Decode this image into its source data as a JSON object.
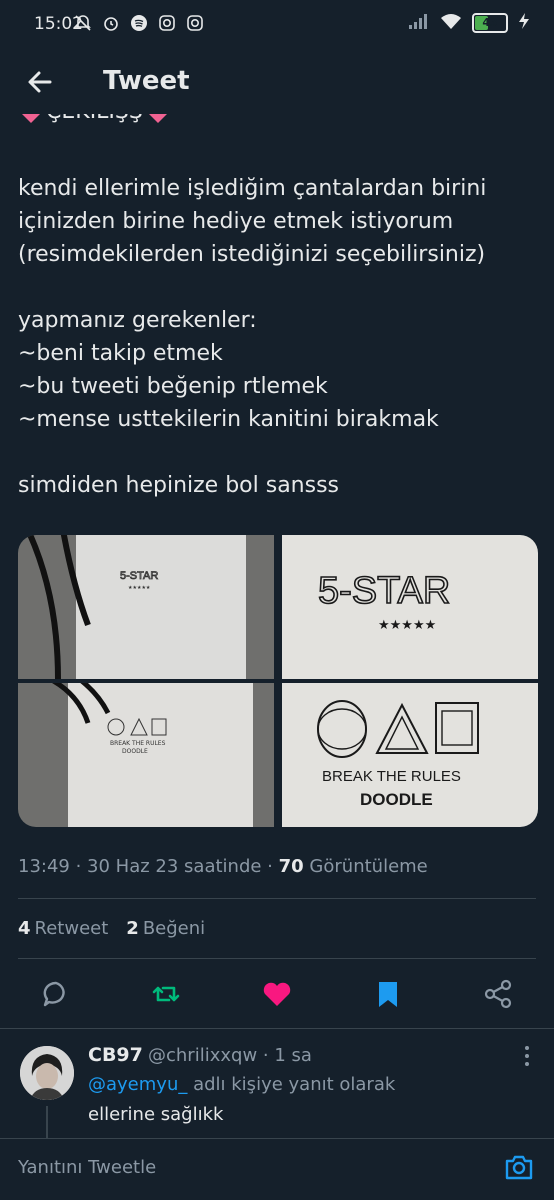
{
  "status_bar": {
    "time": "15:02",
    "battery_level": "43",
    "battery_fraction": 0.43
  },
  "header": {
    "title": "Tweet"
  },
  "tweet": {
    "heading": "ÇEKİLİŞŞ",
    "paragraph_1": "kendi ellerimle işlediğim çantalardan birini\niçinizden birine hediye etmek istiyorum\n(resimdekilerden istediğinizi seçebilirsiniz)",
    "paragraph_2": "yapmanız gerekenler:\n~beni takip etmek\n~bu tweeti beğenip rtlemek\n~mense usttekilerin kanitini birakmak",
    "paragraph_3": "simdiden hepinize bol sansss",
    "images": [
      {
        "embroidery_text": "5-STAR"
      },
      {
        "embroidery_text": "5-STAR"
      },
      {
        "embroidery_text": "BREAK THE RULES",
        "embroidery_sub": "DOODLE"
      },
      {
        "embroidery_text": "BREAK THE RULES",
        "embroidery_sub": "DOODLE"
      }
    ],
    "meta": {
      "time": "13:49",
      "date": "· 30 Haz 23 saatinde ·",
      "views_count": "70",
      "views_label": "Görüntüleme"
    },
    "stats": {
      "retweets_count": "4",
      "retweets_label": "Retweet",
      "likes_count": "2",
      "likes_label": "Beğeni"
    },
    "actions": [
      "reply-icon",
      "retweet-icon",
      "heart-icon",
      "bookmark-icon",
      "share-icon"
    ],
    "colors": {
      "retweet": "#00ba7c",
      "like": "#f91880",
      "bookmark": "#1d9bf0"
    }
  },
  "reply": {
    "name": "CB97",
    "handle": "@chrilixxqw · 1 sa",
    "reply_to_mention": "@ayemyu_",
    "reply_to_suffix": " adlı kişiye yanıt olarak",
    "text": "ellerine sağlıkk"
  },
  "compose": {
    "placeholder": "Yanıtını Tweetle"
  }
}
